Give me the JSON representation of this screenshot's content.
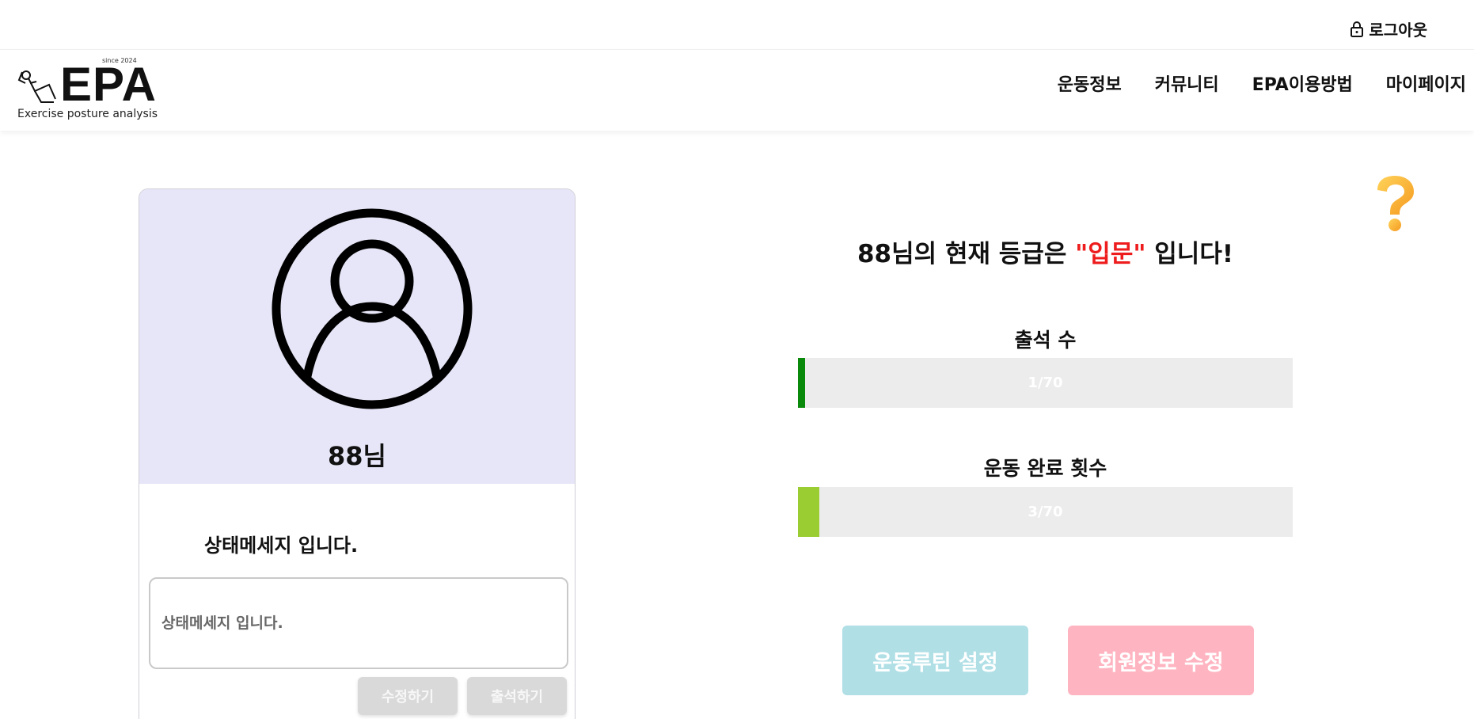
{
  "topbar": {
    "logout_label": "로그아웃"
  },
  "logo": {
    "since": "since 2024",
    "brand": "EPA",
    "tagline": "Exercise posture analysis"
  },
  "nav": {
    "items": [
      "운동정보",
      "커뮤니티",
      "EPA이용방법",
      "마이페이지"
    ]
  },
  "profile": {
    "nickname": "88님",
    "status_message": "상태메세지 입니다.",
    "status_placeholder": "상태메세지 입니다.",
    "edit_button": "수정하기",
    "attend_button": "출석하기"
  },
  "grade": {
    "prefix": "88님의 현재 등급은 ",
    "level": "\"입문\"",
    "suffix": " 입니다!"
  },
  "stats": {
    "attendance": {
      "label": "출석 수",
      "text": "1/70",
      "current": 1,
      "max": 70,
      "color": "#0a8a0a"
    },
    "workouts": {
      "label": "운동 완료 횟수",
      "text": "3/70",
      "current": 3,
      "max": 70,
      "color": "#9acd32"
    }
  },
  "actions": {
    "routine_button": "운동루틴 설정",
    "member_button": "회원정보 수정"
  },
  "colors": {
    "card_bg": "#e6e6f8",
    "grade_highlight": "#ee1c1c",
    "routine_btn": "#b0dfe6",
    "member_btn": "#ffb5c1"
  },
  "icons": {
    "logout": "lock-icon",
    "help": "question-mark-icon",
    "avatar": "user-avatar-icon"
  }
}
